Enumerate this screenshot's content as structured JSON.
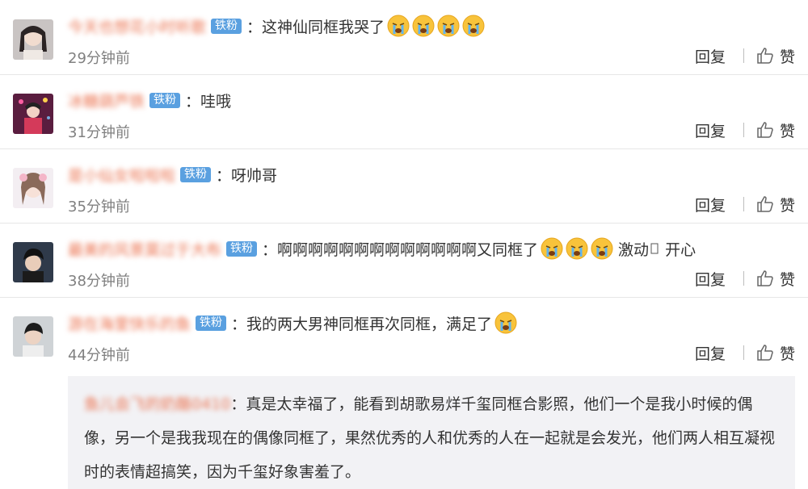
{
  "comments": [
    {
      "username": "今天也想花小时听歌",
      "badge": "铁粉",
      "separator": "：",
      "text": "这神仙同框我哭了",
      "emoji_count": 4,
      "emoji": "crying-face",
      "time": "29分钟前",
      "reply_label": "回复",
      "like_label": "赞"
    },
    {
      "username": "冰糖葫芦铁",
      "badge": "铁粉",
      "separator": "：",
      "text": "哇哦",
      "time": "31分钟前",
      "reply_label": "回复",
      "like_label": "赞"
    },
    {
      "username": "是小仙女啦啦啦",
      "badge": "铁粉",
      "separator": "：",
      "text": "呀帅哥",
      "time": "35分钟前",
      "reply_label": "回复",
      "like_label": "赞"
    },
    {
      "username": "最美的风景莫过于大布",
      "badge": "铁粉",
      "separator": "：",
      "text": "啊啊啊啊啊啊啊啊啊啊啊啊啊又同框了",
      "emoji_count": 3,
      "emoji": "crying-face",
      "tail_text": "激动",
      "tail_text2": "开心",
      "time": "38分钟前",
      "reply_label": "回复",
      "like_label": "赞"
    },
    {
      "username": "游在海里快乐的鱼",
      "badge": "铁粉",
      "separator": "：",
      "text": "我的两大男神同框再次同框，满足了",
      "emoji_count": 1,
      "emoji": "crying-face",
      "time": "44分钟前",
      "reply_label": "回复",
      "like_label": "赞"
    }
  ],
  "sub_reply": {
    "username": "鱼儿会飞的奶酪0410",
    "separator": "：",
    "text": "真是太幸福了，能看到胡歌易烊千玺同框合影照，他们一个是我小时候的偶像，另一个是我我现在的偶像同框了，果然优秀的人和优秀的人在一起就是会发光，他们两人相互凝视时的表情超搞笑，因为千玺好象害羞了。"
  },
  "colors": {
    "username": "#eb7350",
    "badge_bg": "#5aa0e0",
    "time": "#808080",
    "subreply_bg": "#f2f2f5"
  }
}
